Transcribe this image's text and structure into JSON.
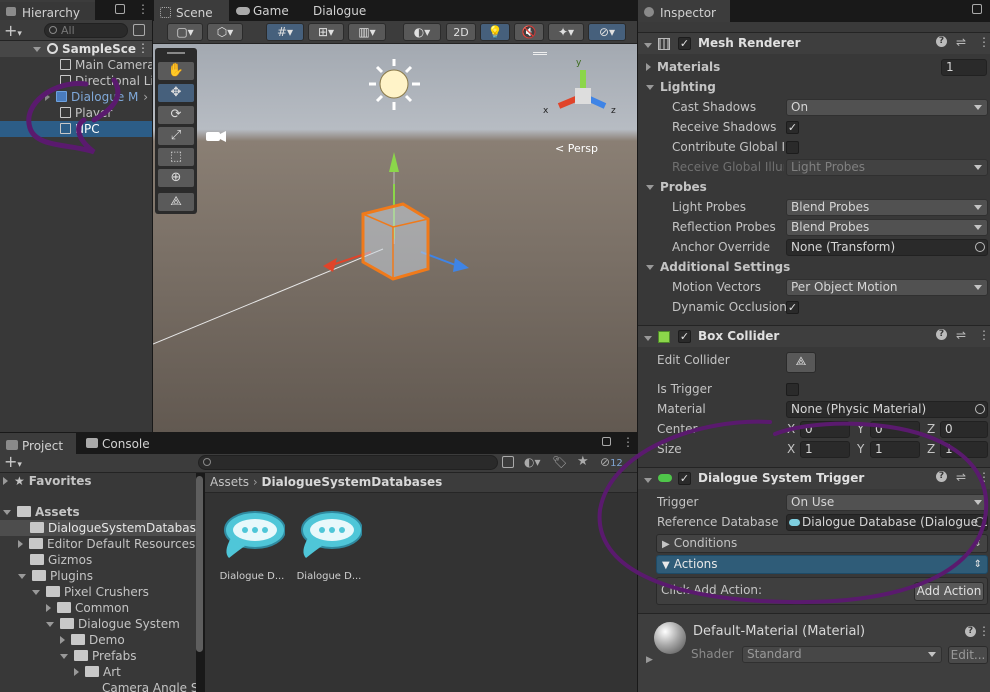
{
  "hierarchy": {
    "tab": "Hierarchy",
    "search_placeholder": "All",
    "scene": "SampleSce",
    "items": [
      "Main Camera",
      "Directional Li",
      "Dialogue M",
      "Player",
      "NPC"
    ]
  },
  "scene_tabs": {
    "scene": "Scene",
    "game": "Game",
    "dialogue": "Dialogue"
  },
  "scene_toolbar": {
    "mode_2d": "2D"
  },
  "scene_view": {
    "persp_label": "< Persp",
    "gizmo_x": "x",
    "gizmo_y": "y",
    "gizmo_z": "z"
  },
  "project": {
    "tab_project": "Project",
    "tab_console": "Console",
    "favorites": "Favorites",
    "assets": "Assets",
    "tree": [
      "DialogueSystemDatabase",
      "Editor Default Resources",
      "Gizmos",
      "Plugins",
      "Pixel Crushers",
      "Common",
      "Dialogue System",
      "Demo",
      "Prefabs",
      "Art",
      "Camera Angle S"
    ],
    "breadcrumb_root": "Assets",
    "breadcrumb_leaf": "DialogueSystemDatabases",
    "files": [
      "Dialogue D...",
      "Dialogue D..."
    ],
    "hidden_count": "12"
  },
  "inspector": {
    "tab": "Inspector",
    "mesh_renderer": {
      "title": "Mesh Renderer",
      "materials_label": "Materials",
      "materials_value": "1",
      "lighting": "Lighting",
      "cast_shadows_label": "Cast Shadows",
      "cast_shadows_value": "On",
      "receive_shadows_label": "Receive Shadows",
      "contribute_gi_label": "Contribute Global Ill",
      "receive_gi_label": "Receive Global Illum",
      "receive_gi_value": "Light Probes",
      "probes": "Probes",
      "light_probes_label": "Light Probes",
      "light_probes_value": "Blend Probes",
      "reflection_probes_label": "Reflection Probes",
      "reflection_probes_value": "Blend Probes",
      "anchor_label": "Anchor Override",
      "anchor_value": "None (Transform)",
      "additional": "Additional Settings",
      "motion_label": "Motion Vectors",
      "motion_value": "Per Object Motion",
      "dynamic_occ_label": "Dynamic Occlusion"
    },
    "box_collider": {
      "title": "Box Collider",
      "edit_label": "Edit Collider",
      "trigger_label": "Is Trigger",
      "material_label": "Material",
      "material_value": "None (Physic Material)",
      "center_label": "Center",
      "size_label": "Size",
      "x": "X",
      "y": "Y",
      "z": "Z",
      "center_x": "0",
      "center_y": "0",
      "center_z": "0",
      "size_x": "1",
      "size_y": "1",
      "size_z": "1"
    },
    "dst": {
      "title": "Dialogue System Trigger",
      "trigger_label": "Trigger",
      "trigger_value": "On Use",
      "refdb_label": "Reference Database",
      "refdb_value": "Dialogue Database (Dialogue D",
      "conditions": "Conditions",
      "actions": "Actions",
      "click_add": "Click Add Action:",
      "add_action": "Add Action"
    },
    "material": {
      "title": "Default-Material (Material)",
      "shader_label": "Shader",
      "shader_value": "Standard",
      "edit": "Edit..."
    }
  },
  "colors": {
    "selection": "#2c5d87",
    "accent_blue": "#4a8bd6",
    "annotation": "#5a1a6e"
  }
}
